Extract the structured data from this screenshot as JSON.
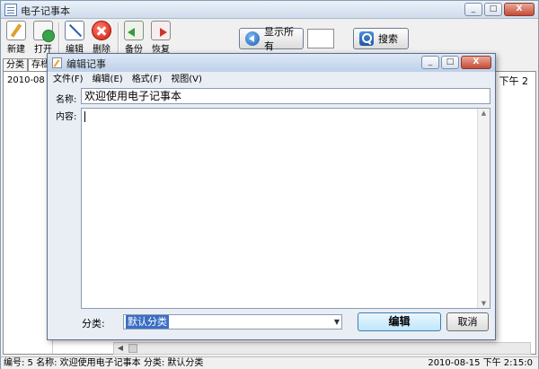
{
  "main_window": {
    "title": "电子记事本",
    "minimize": "_",
    "maximize": "□",
    "close": "X"
  },
  "toolbar": {
    "new_label": "新建",
    "open_label": "打开",
    "edit_label": "编辑",
    "delete_label": "删除",
    "backup_label": "备份",
    "restore_label": "恢复",
    "show_all_label": "显示所有",
    "search_label": "搜索",
    "search_value": ""
  },
  "list": {
    "tabs": [
      "分类",
      "存档"
    ],
    "row_date": "2010-08",
    "row_date_right": "15 下午 2"
  },
  "status_bar": {
    "left": "编号: 5  名称: 欢迎使用电子记事本  分类: 默认分类",
    "right": "2010-08-15 下午 2:15:0"
  },
  "dialog": {
    "title": "编辑记事",
    "minimize": "_",
    "maximize": "□",
    "close": "X",
    "menu": [
      "文件(F)",
      "编辑(E)",
      "格式(F)",
      "视图(V)"
    ],
    "name_label": "名称:",
    "name_value": "欢迎使用电子记事本",
    "content_label": "内容:",
    "content_value": "",
    "category_label": "分类:",
    "category_value": "默认分类",
    "edit_button": "编辑",
    "cancel_button": "取消"
  }
}
